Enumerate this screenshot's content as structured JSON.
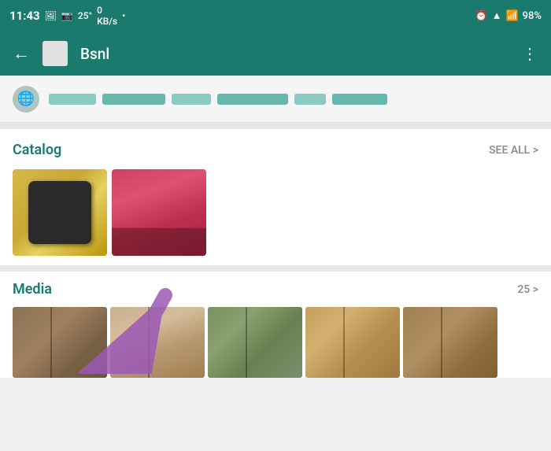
{
  "statusBar": {
    "time": "11:43",
    "temperature": "25°",
    "network": "0\nKB/s",
    "battery": "98%"
  },
  "appBar": {
    "title": "Bsnl",
    "backLabel": "←",
    "moreLabel": "⋮"
  },
  "catalog": {
    "title": "Catalog",
    "seeAll": "SEE ALL >",
    "image1Alt": "phone-back-dark",
    "image2Alt": "phone-back-red"
  },
  "media": {
    "title": "Media",
    "count": "25 >"
  },
  "blurredRow": {
    "blocks": [
      60,
      80,
      50,
      90,
      40,
      70
    ]
  }
}
